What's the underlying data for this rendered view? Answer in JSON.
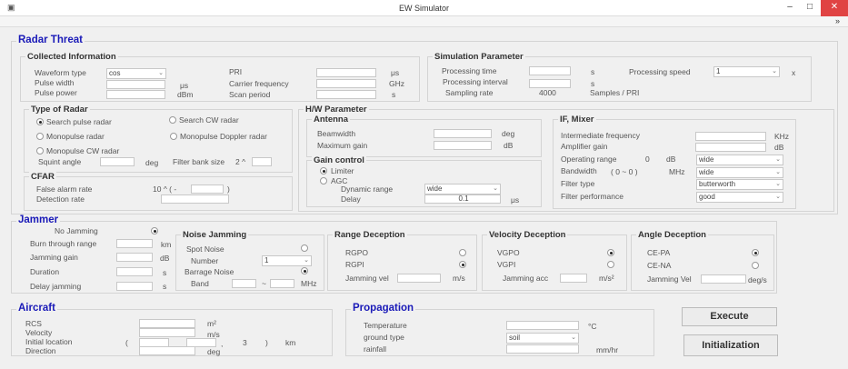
{
  "window": {
    "title": "EW Simulator",
    "minimize": "–",
    "maximize": "□",
    "close": "✕",
    "toolbar_more": "»"
  },
  "radar": {
    "title": "Radar Threat",
    "collected": {
      "title": "Collected Information",
      "waveform_label": "Waveform type",
      "waveform_value": "cos",
      "pulse_width_label": "Pulse width",
      "pulse_width_unit": "μs",
      "pulse_power_label": "Pulse power",
      "pulse_power_unit": "dBm",
      "pri_label": "PRI",
      "pri_unit": "μs",
      "carrier_label": "Carrier frequency",
      "carrier_unit": "GHz",
      "scan_label": "Scan period",
      "scan_unit": "s"
    },
    "sim": {
      "title": "Simulation Parameter",
      "ptime_label": "Processing time",
      "ptime_unit": "s",
      "pinterval_label": "Processing interval",
      "pinterval_unit": "s",
      "speed_label": "Processing speed",
      "speed_value": "1",
      "speed_unit": "x",
      "sampling_label": "Sampling rate",
      "sampling_value": "4000",
      "sampling_unit": "Samples / PRI"
    },
    "type": {
      "title": "Type of Radar",
      "options": [
        {
          "label": "Search pulse radar",
          "checked": true
        },
        {
          "label": "Search CW radar",
          "checked": false
        },
        {
          "label": "Monopulse radar",
          "checked": false
        },
        {
          "label": "Monopulse Doppler radar",
          "checked": false
        },
        {
          "label": "Monopulse CW radar",
          "checked": false
        }
      ],
      "squint_label": "Squint angle",
      "squint_unit": "deg",
      "filter_label": "Filter bank size",
      "filter_prefix": "2 ^"
    },
    "cfar": {
      "title": "CFAR",
      "far_label": "False alarm rate",
      "far_prefix": "10 ^  ( -",
      "far_suffix": ")",
      "det_label": "Detection rate"
    },
    "hw": {
      "title": "H/W Parameter",
      "antenna": {
        "title": "Antenna",
        "beam_label": "Beamwidth",
        "beam_unit": "deg",
        "gain_label": "Maximum gain",
        "gain_unit": "dB"
      },
      "gain": {
        "title": "Gain control",
        "limiter": "Limiter",
        "limiter_checked": true,
        "agc": "AGC",
        "agc_checked": false,
        "dyn_label": "Dynamic range",
        "dyn_value": "wide",
        "delay_label": "Delay",
        "delay_value": "0.1",
        "delay_unit": "μs"
      },
      "if": {
        "title": "IF, Mixer",
        "ifreq_label": "Intermediate frequency",
        "ifreq_unit": "KHz",
        "amp_label": "Amplifier gain",
        "amp_unit": "dB",
        "op_label": "Operating range",
        "op_value": "0",
        "op_unit": "dB",
        "op_select": "wide",
        "bw_label": "Bandwidth",
        "bw_range": "(  0  ~  0  )",
        "bw_unit": "MHz",
        "bw_select": "wide",
        "ftype_label": "Filter type",
        "ftype_value": "butterworth",
        "fperf_label": "Filter performance",
        "fperf_value": "good"
      }
    }
  },
  "jammer": {
    "title": "Jammer",
    "no_jam": "No Jamming",
    "no_jam_checked": true,
    "burn_label": "Burn through range",
    "burn_unit": "km",
    "jgain_label": "Jamming gain",
    "jgain_unit": "dB",
    "dur_label": "Duration",
    "dur_unit": "s",
    "delay_label": "Delay jamming",
    "delay_unit": "s",
    "noise": {
      "title": "Noise Jamming",
      "spot": "Spot Noise",
      "spot_checked": false,
      "number_label": "Number",
      "number_value": "1",
      "barrage": "Barrage Noise",
      "barrage_checked": true,
      "band_label": "Band",
      "band_sep": "~",
      "band_unit": "MHz"
    },
    "range": {
      "title": "Range Deception",
      "rgpo": "RGPO",
      "rgpo_checked": false,
      "rgpi": "RGPI",
      "rgpi_checked": true,
      "vel_label": "Jamming vel",
      "vel_unit": "m/s"
    },
    "velocity": {
      "title": "Velocity Deception",
      "vgpo": "VGPO",
      "vgpo_checked": true,
      "vgpi": "VGPI",
      "vgpi_checked": false,
      "acc_label": "Jamming acc",
      "acc_unit": "m/s²"
    },
    "angle": {
      "title": "Angle Deception",
      "cepa": "CE-PA",
      "cepa_checked": true,
      "cena": "CE-NA",
      "cena_checked": false,
      "vel_label": "Jamming Vel",
      "vel_unit": "deg/s"
    }
  },
  "aircraft": {
    "title": "Aircraft",
    "rcs_label": "RCS",
    "rcs_unit": "m²",
    "vel_label": "Velocity",
    "vel_unit": "m/s",
    "loc_label": "Initial location",
    "loc_open": "(",
    "loc_sep1": "_",
    "loc_sep2": ",",
    "loc_z": "3",
    "loc_close": ")",
    "loc_unit": "km",
    "dir_label": "Direction",
    "dir_unit": "deg"
  },
  "propagation": {
    "title": "Propagation",
    "temp_label": "Temperature",
    "temp_unit": "°C",
    "ground_label": "ground type",
    "ground_value": "soil",
    "rain_label": "rainfall",
    "rain_unit": "mm/hr"
  },
  "buttons": {
    "execute": "Execute",
    "init": "Initialization"
  }
}
